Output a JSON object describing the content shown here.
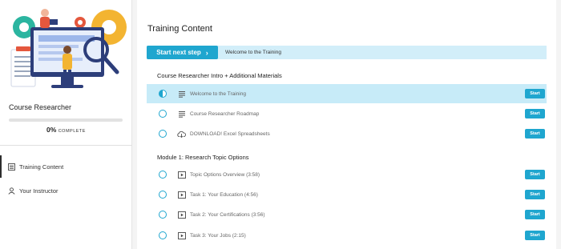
{
  "sidebar": {
    "course_title": "Course Researcher",
    "progress": {
      "fraction": 0.0,
      "percent_text": "0%",
      "complete_label": "COMPLETE"
    },
    "nav": [
      {
        "label": "Training Content",
        "icon": "list-icon",
        "active": true
      },
      {
        "label": "Your Instructor",
        "icon": "user-icon",
        "active": false
      }
    ]
  },
  "main": {
    "title": "Training Content",
    "next_step": {
      "button_label": "Start next step",
      "chevron": "›",
      "caption": "Welcome to the Training"
    },
    "sections": [
      {
        "title": "Course Researcher Intro + Additional Materials",
        "lessons": [
          {
            "title": "Welcome to the Training",
            "type": "text-icon",
            "status": "in-progress",
            "action": "Start"
          },
          {
            "title": "Course Researcher Roadmap",
            "type": "text-icon",
            "status": "not-started",
            "action": "Start"
          },
          {
            "title": "DOWNLOAD! Excel Spreadsheets",
            "type": "download-icon",
            "status": "not-started",
            "action": "Start"
          }
        ]
      },
      {
        "title": "Module 1: Research Topic Options",
        "lessons": [
          {
            "title": "Topic Options Overview (3:58)",
            "type": "video-icon",
            "status": "not-started",
            "action": "Start"
          },
          {
            "title": "Task 1: Your Education (4:56)",
            "type": "video-icon",
            "status": "not-started",
            "action": "Start"
          },
          {
            "title": "Task 2: Your Certifications (3:56)",
            "type": "video-icon",
            "status": "not-started",
            "action": "Start"
          },
          {
            "title": "Task 3: Your Jobs (2:15)",
            "type": "video-icon",
            "status": "not-started",
            "action": "Start"
          }
        ]
      }
    ]
  },
  "colors": {
    "accent": "#1fa6cf",
    "highlight": "#c7ebf8",
    "next_bar_bg": "#d2eef9"
  }
}
